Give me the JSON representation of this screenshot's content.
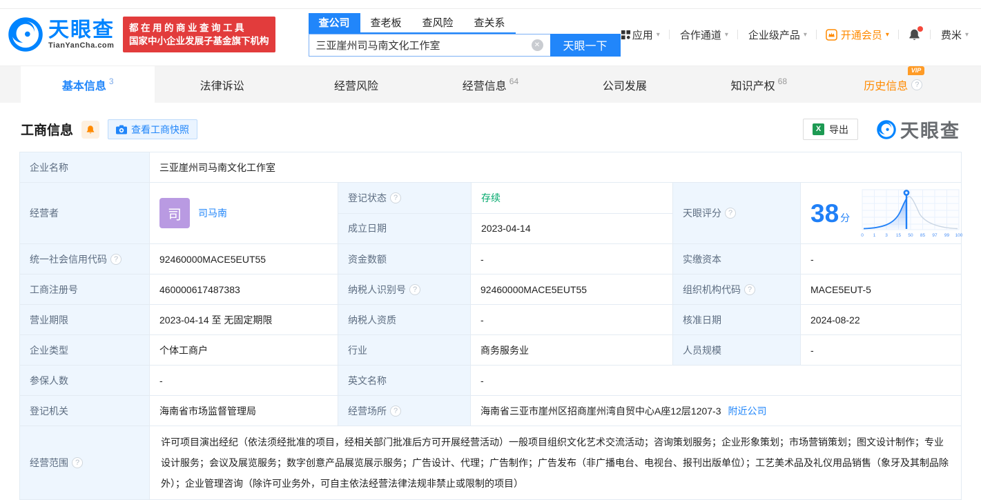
{
  "icons": {
    "help": "?",
    "clear": "✕",
    "caret": "▾",
    "excel": "X"
  },
  "brand": {
    "logo_text": "天眼查",
    "logo_domain": "TianYanCha.com",
    "slogan_line1": "都在用的商业查询工具",
    "slogan_line2": "国家中小企业发展子基金旗下机构"
  },
  "search": {
    "tabs": [
      {
        "label": "查公司",
        "active": true
      },
      {
        "label": "查老板",
        "active": false
      },
      {
        "label": "查风险",
        "active": false
      },
      {
        "label": "查关系",
        "active": false
      }
    ],
    "input_value": "三亚崖州司马南文化工作室",
    "button_label": "天眼一下"
  },
  "top_menu": {
    "items": [
      {
        "label": "应用"
      },
      {
        "label": "合作通道"
      },
      {
        "label": "企业级产品"
      },
      {
        "label": "开通会员"
      },
      {
        "label": "费米"
      }
    ]
  },
  "nav_tabs": [
    {
      "label": "基本信息",
      "count": "3",
      "active": true
    },
    {
      "label": "法律诉讼",
      "count": ""
    },
    {
      "label": "经营风险",
      "count": ""
    },
    {
      "label": "经营信息",
      "count": "64"
    },
    {
      "label": "公司发展",
      "count": ""
    },
    {
      "label": "知识产权",
      "count": "68"
    },
    {
      "label": "历史信息",
      "count": "",
      "badge": "VIP"
    }
  ],
  "section": {
    "title": "工商信息",
    "snapshot_button": "查看工商快照",
    "export_button": "导出",
    "watermark": "天眼查"
  },
  "score": {
    "label": "天眼评分",
    "value": "38",
    "unit": "分",
    "marker_value": 38,
    "axis_ticks": [
      "0",
      "1",
      "3",
      "15",
      "50",
      "85",
      "97",
      "99",
      "100"
    ]
  },
  "fields": {
    "name": {
      "label": "企业名称",
      "value": "三亚崖州司马南文化工作室"
    },
    "operator": {
      "label": "经营者",
      "name": "司马南",
      "avatar": "司"
    },
    "status": {
      "label": "登记状态",
      "value": "存续"
    },
    "established": {
      "label": "成立日期",
      "value": "2023-04-14"
    },
    "credit_code": {
      "label": "统一社会信用代码",
      "value": "92460000MACE5EUT55"
    },
    "capital": {
      "label": "资金数额",
      "value": "-"
    },
    "paid_capital": {
      "label": "实缴资本",
      "value": "-"
    },
    "reg_no": {
      "label": "工商注册号",
      "value": "460000617487383"
    },
    "taxpayer_no": {
      "label": "纳税人识别号",
      "value": "92460000MACE5EUT55"
    },
    "org_code": {
      "label": "组织机构代码",
      "value": "MACE5EUT-5"
    },
    "term": {
      "label": "营业期限",
      "value": "2023-04-14 至 无固定期限"
    },
    "taxpayer_qual": {
      "label": "纳税人资质",
      "value": "-"
    },
    "approval_date": {
      "label": "核准日期",
      "value": "2024-08-22"
    },
    "type": {
      "label": "企业类型",
      "value": "个体工商户"
    },
    "industry": {
      "label": "行业",
      "value": "商务服务业"
    },
    "staff": {
      "label": "人员规模",
      "value": "-"
    },
    "insured": {
      "label": "参保人数",
      "value": "-"
    },
    "english_name": {
      "label": "英文名称",
      "value": "-"
    },
    "authority": {
      "label": "登记机关",
      "value": "海南省市场监督管理局"
    },
    "address": {
      "label": "经营场所",
      "value": "海南省三亚市崖州区招商崖州湾自贸中心A座12层1207-3",
      "nearby_link": "附近公司"
    },
    "scope": {
      "label": "经营范围",
      "value": "许可项目演出经纪（依法须经批准的项目，经相关部门批准后方可开展经营活动）一般项目组织文化艺术交流活动；咨询策划服务；企业形象策划；市场营销策划；图文设计制作；专业设计服务；会议及展览服务；数字创意产品展览展示服务；广告设计、代理；广告制作；广告发布（非广播电台、电视台、报刊出版单位）；工艺美术品及礼仪用品销售（象牙及其制品除外）；企业管理咨询（除许可业务外，可自主依法经营法律法规非禁止或限制的项目）"
    }
  }
}
